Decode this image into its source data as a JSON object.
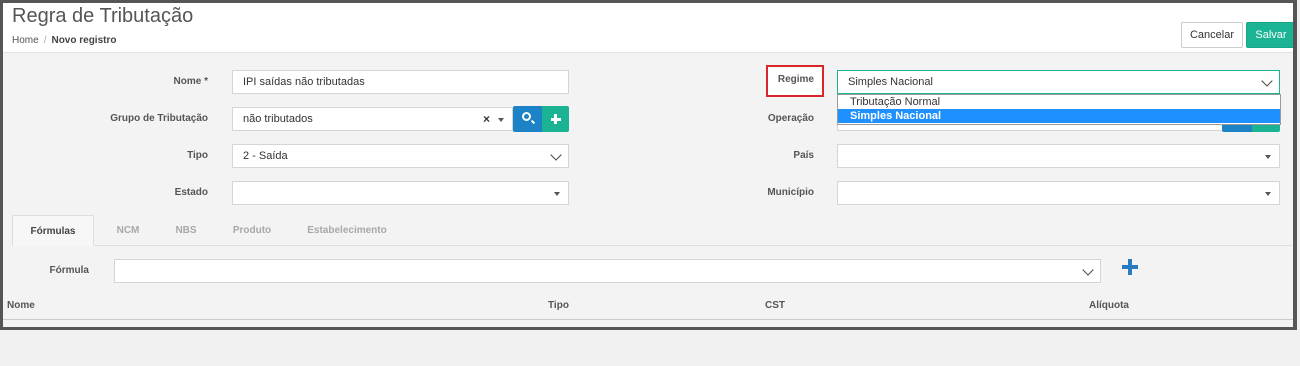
{
  "header": {
    "title": "Regra de Tributação",
    "breadcrumb": {
      "home": "Home",
      "separator": "/",
      "current": "Novo registro"
    },
    "cancel_label": "Cancelar",
    "save_label": "Salvar"
  },
  "form": {
    "nome": {
      "label": "Nome *",
      "value": "IPI saídas não tributadas"
    },
    "grupo": {
      "label": "Grupo de Tributação",
      "value": "não tributados",
      "clear": "×"
    },
    "tipo": {
      "label": "Tipo",
      "value": "2 - Saída"
    },
    "estado": {
      "label": "Estado",
      "value": ""
    },
    "regime": {
      "label": "Regime",
      "value": "Simples Nacional",
      "options": [
        "Tributação Normal",
        "Simples Nacional"
      ],
      "selected": "Simples Nacional"
    },
    "operacao": {
      "label": "Operação"
    },
    "pais": {
      "label": "País",
      "value": ""
    },
    "municipio": {
      "label": "Município",
      "value": ""
    }
  },
  "tabs": [
    {
      "label": "Fórmulas",
      "active": true
    },
    {
      "label": "NCM",
      "active": false
    },
    {
      "label": "NBS",
      "active": false
    },
    {
      "label": "Produto",
      "active": false
    },
    {
      "label": "Estabelecimento",
      "active": false
    }
  ],
  "formula": {
    "label": "Fórmula",
    "value": ""
  },
  "table": {
    "columns": [
      "Nome",
      "Tipo",
      "CST",
      "Alíquota"
    ]
  },
  "colors": {
    "primary_green": "#1ab394",
    "primary_blue": "#1c84c6",
    "highlight_red": "#d9262b",
    "selected_option": "#1e90ff"
  },
  "icons": [
    "search-icon",
    "plus-icon",
    "chevron-down-icon",
    "caret-down-icon",
    "clear-icon"
  ]
}
